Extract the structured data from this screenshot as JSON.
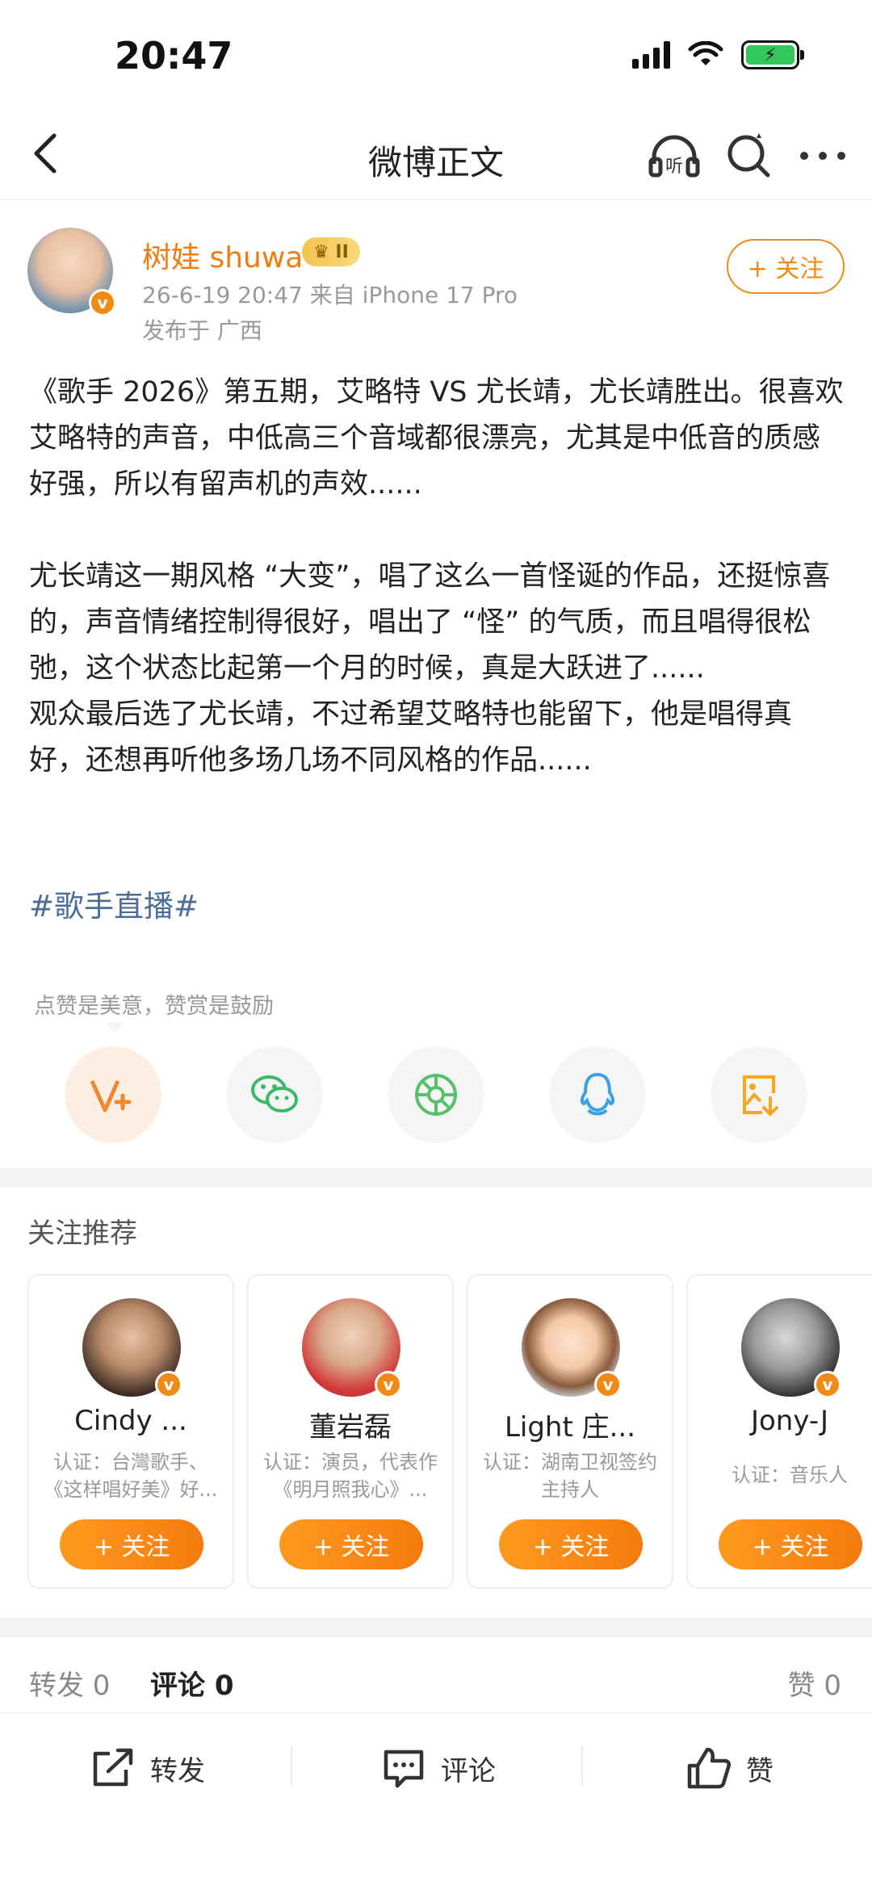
{
  "status_bar": {
    "time": "20:47"
  },
  "nav": {
    "title": "微博正文",
    "listen_label": "听"
  },
  "post": {
    "author": "树娃 shuwa",
    "level_badge": "II",
    "meta": "26-6-19 20:47  来自 iPhone 17 Pro",
    "location": "发布于 广西",
    "follow_label": "+ 关注",
    "paragraphs": [
      "《歌手 2026》第五期，艾略特 VS 尤长靖，尤长靖胜出。很喜欢艾略特的声音，中低高三个音域都很漂亮，尤其是中低音的质感好强，所以有留声机的声效......",
      "尤长靖这一期风格 “大变”，唱了这么一首怪诞的作品，还挺惊喜的，声音情绪控制得很好，唱出了 “怪” 的气质，而且唱得很松弛，这个状态比起第一个月的时候，真是大跃进了......",
      "观众最后选了尤长靖，不过希望艾略特也能留下，他是唱得真好，还想再听他多场几场不同风格的作品......"
    ],
    "hashtag": "#歌手直播#"
  },
  "reward_tip": "点赞是美意，赞赏是鼓励",
  "share_buttons": [
    {
      "icon": "reward-icon",
      "color": "#f0882d"
    },
    {
      "icon": "wechat-icon",
      "color": "#3bb96b"
    },
    {
      "icon": "moments-icon",
      "color": "#56c06a"
    },
    {
      "icon": "qq-icon",
      "color": "#3aa0e6"
    },
    {
      "icon": "save-image-icon",
      "color": "#f5a623"
    }
  ],
  "recommend": {
    "title": "关注推荐",
    "follow_label": "+ 关注",
    "cards": [
      {
        "name": "Cindy ...",
        "desc": "认证：台灣歌手、《这样唱好美》好..."
      },
      {
        "name": "董岩磊",
        "desc": "认证：演员，代表作《明月照我心》..."
      },
      {
        "name": "Light 庄...",
        "desc": "认证：湖南卫视签约主持人"
      },
      {
        "name": "Jony-J",
        "desc": "认证：音乐人"
      }
    ]
  },
  "stats": {
    "repost": "转发 0",
    "comment": "评论 0",
    "like": "赞 0"
  },
  "toolbar": {
    "repost": "转发",
    "comment": "评论",
    "like": "赞"
  },
  "colors": {
    "accent": "#f08a14",
    "link": "#4c6d96"
  }
}
